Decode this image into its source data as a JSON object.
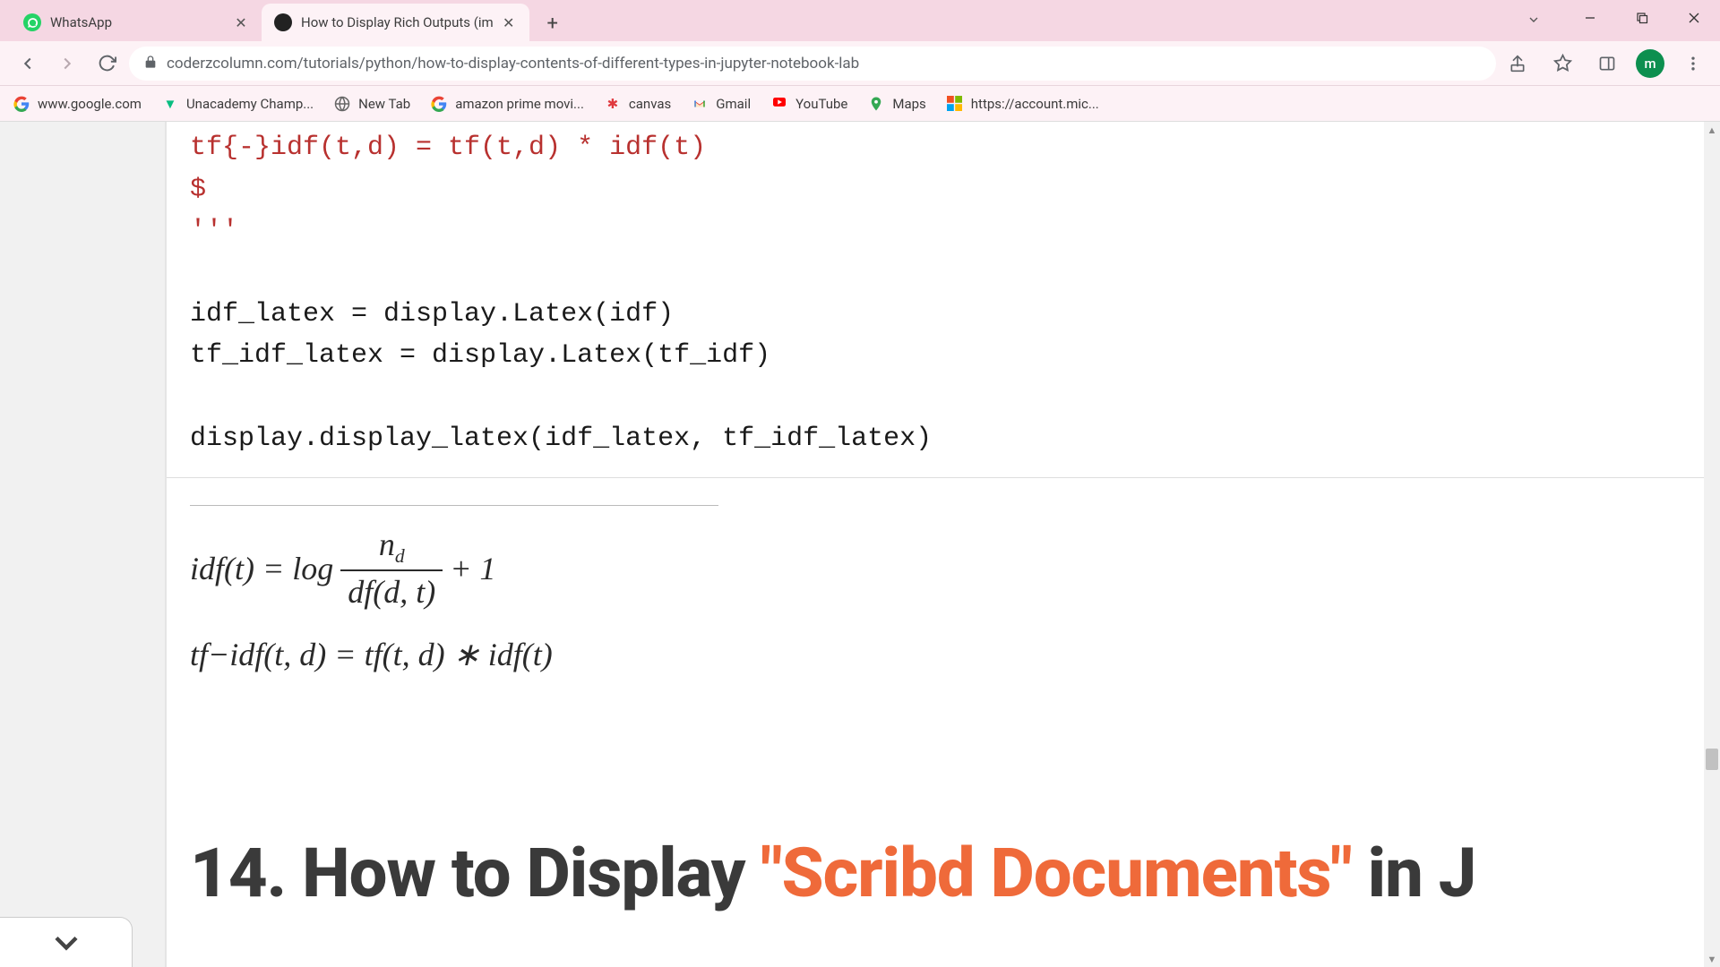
{
  "tabs": [
    {
      "title": "WhatsApp",
      "active": false
    },
    {
      "title": "How to Display Rich Outputs (im",
      "active": true
    }
  ],
  "url": "coderzcolumn.com/tutorials/python/how-to-display-contents-of-different-types-in-jupyter-notebook-lab",
  "avatar_letter": "m",
  "bookmarks": [
    {
      "label": "www.google.com",
      "icon": "google"
    },
    {
      "label": "Unacademy Champ...",
      "icon": "unacademy"
    },
    {
      "label": "New Tab",
      "icon": "globe"
    },
    {
      "label": "amazon prime movi...",
      "icon": "google"
    },
    {
      "label": "canvas",
      "icon": "canvas"
    },
    {
      "label": "Gmail",
      "icon": "gmail"
    },
    {
      "label": "YouTube",
      "icon": "youtube"
    },
    {
      "label": "Maps",
      "icon": "maps"
    },
    {
      "label": "https://account.mic...",
      "icon": "ms"
    }
  ],
  "code": {
    "line1": "tf{-}idf(t,d) = tf(t,d) * idf(t)",
    "line2": "$",
    "line3": "'''",
    "line4": "idf_latex = display.Latex(idf)",
    "line5": "tf_idf_latex = display.Latex(tf_idf)",
    "line6": "display.display_latex(idf_latex, tf_idf_latex)"
  },
  "math": {
    "eq1_lhs": "idf(t) = log",
    "eq1_num": "n",
    "eq1_num_sub": "d",
    "eq1_den": "df(d, t)",
    "eq1_tail": " + 1",
    "eq2": "tf−idf(t, d) = tf(t, d) ∗ idf(t)"
  },
  "heading": {
    "prefix": "14. How to Display ",
    "highlight": "\"Scribd Documents\"",
    "suffix": " in J"
  }
}
